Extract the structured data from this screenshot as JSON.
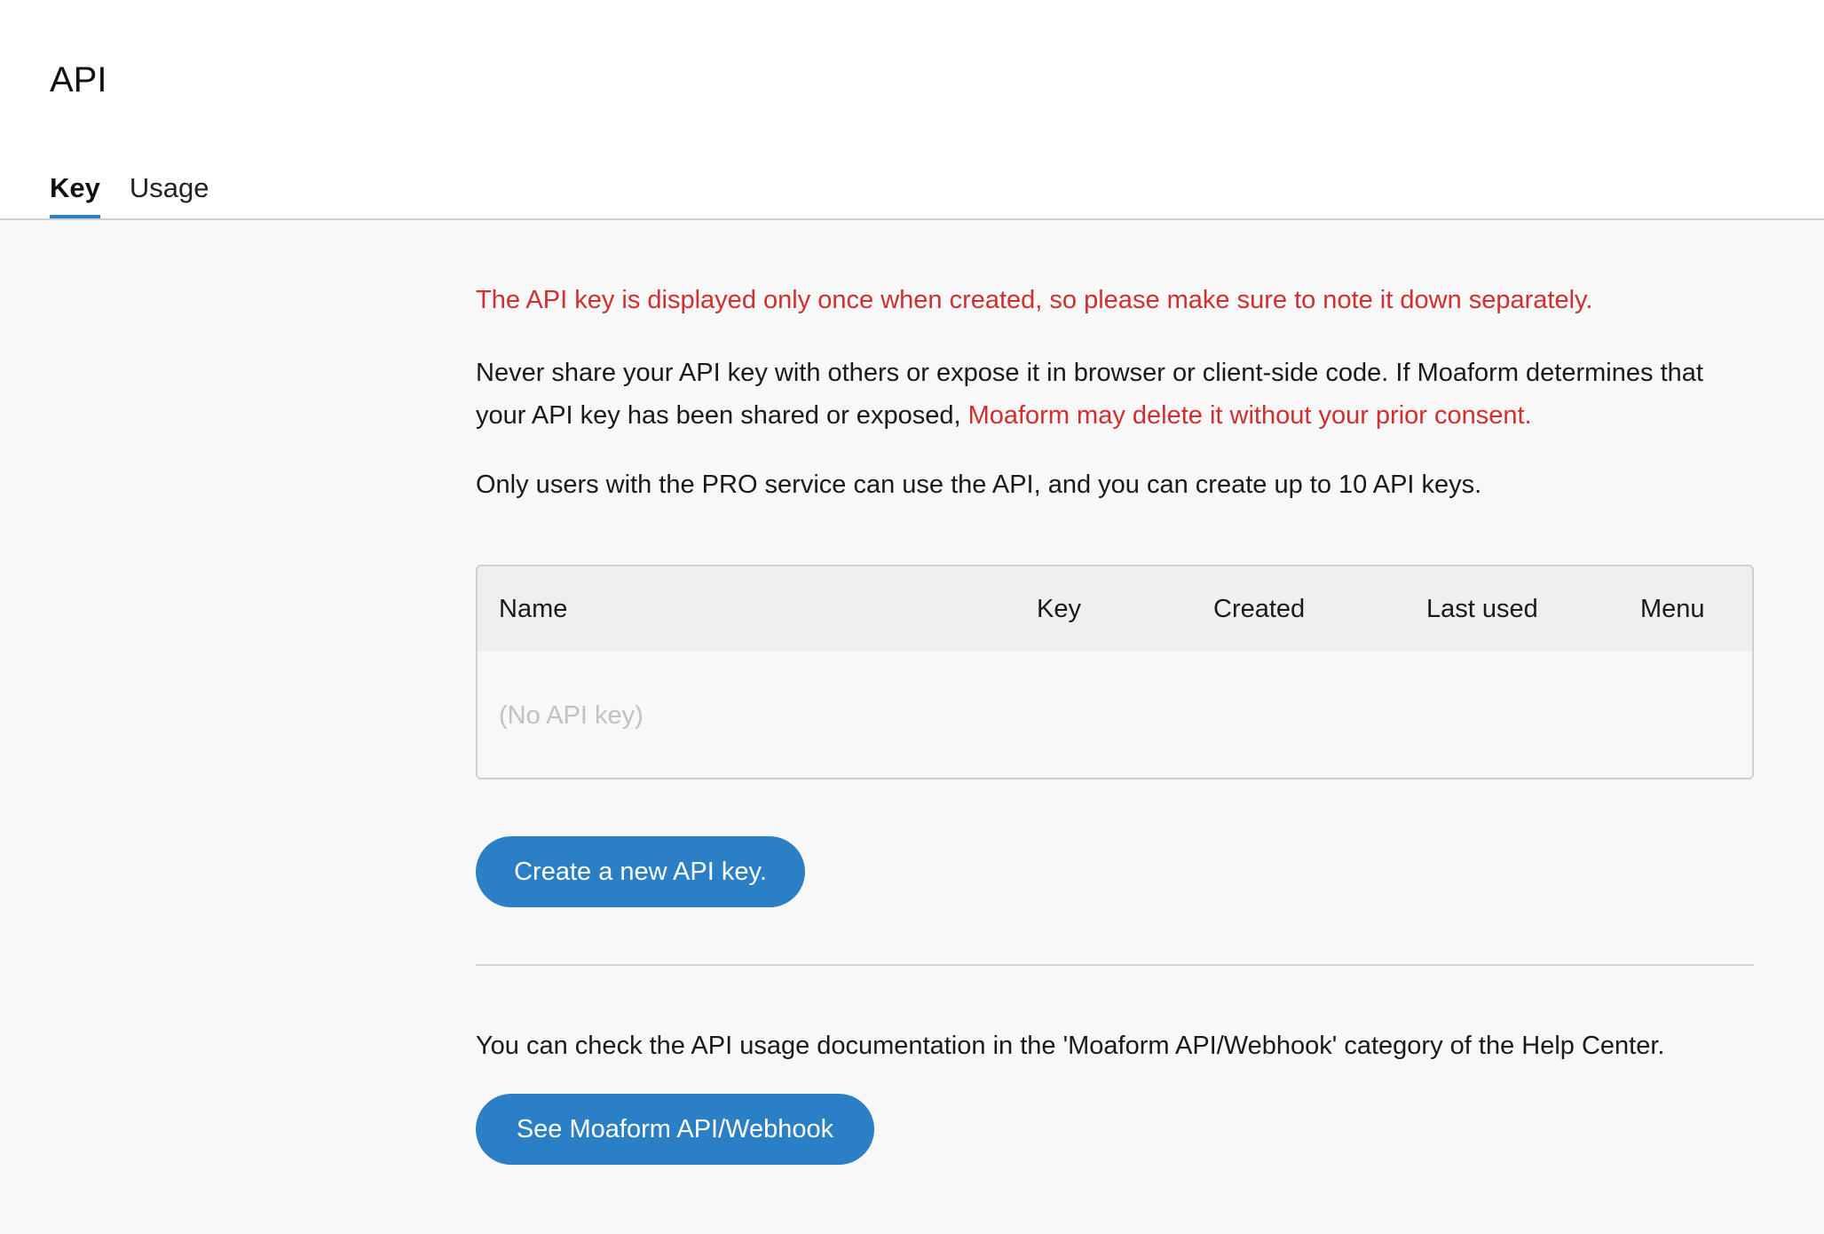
{
  "header": {
    "title": "API",
    "tabs": [
      {
        "label": "Key",
        "active": true
      },
      {
        "label": "Usage",
        "active": false
      }
    ]
  },
  "notices": {
    "red_notice": "The API key is displayed only once when created, so please make sure to note it down separately.",
    "share_warning_prefix": "Never share your API key with others or expose it in browser or client-side code. If Moaform determines that your API key has been shared or exposed, ",
    "share_warning_red": "Moaform may delete it without your prior consent.",
    "pro_info": "Only users with the PRO service can use the API, and you can create up to 10 API keys."
  },
  "table": {
    "columns": [
      "Name",
      "Key",
      "Created",
      "Last used",
      "Menu"
    ],
    "rows": [],
    "empty_text": "(No API key)"
  },
  "actions": {
    "create_label": "Create a new API key.",
    "help_text": "You can check the API usage documentation in the 'Moaform API/Webhook' category of the Help Center.",
    "docs_label": "See Moaform API/Webhook"
  },
  "colors": {
    "accent": "#2b7fc4",
    "warning": "#d02f2f",
    "placeholder": "#c2c2c2"
  }
}
